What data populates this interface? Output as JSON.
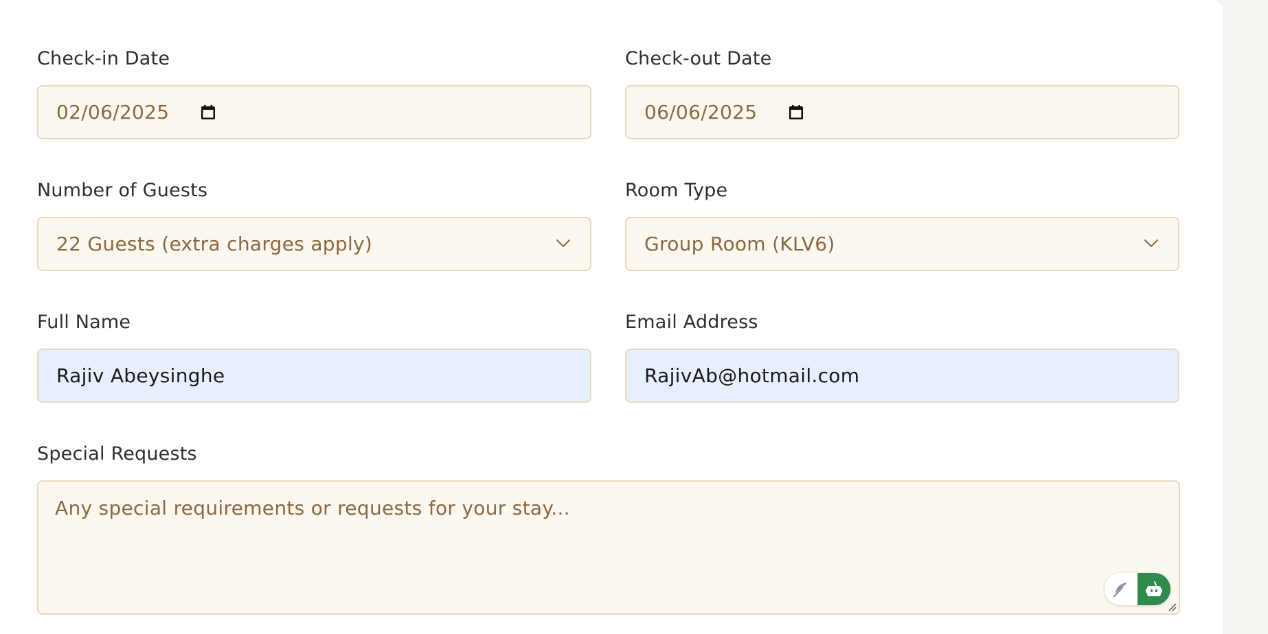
{
  "form": {
    "checkin": {
      "label": "Check-in Date",
      "value": "02/06/2025"
    },
    "checkout": {
      "label": "Check-out Date",
      "value": "06/06/2025"
    },
    "guests": {
      "label": "Number of Guests",
      "value": "22 Guests (extra charges apply)"
    },
    "room_type": {
      "label": "Room Type",
      "value": "Group Room (KLV6)"
    },
    "full_name": {
      "label": "Full Name",
      "value": "Rajiv Abeysinghe"
    },
    "email": {
      "label": "Email Address",
      "value": "RajivAb@hotmail.com"
    },
    "special_requests": {
      "label": "Special Requests",
      "placeholder": "Any special requirements or requests for your stay..."
    }
  },
  "icons": {
    "date": "calendar-icon",
    "select": "chevron-down-icon",
    "widget_left": "feather-icon",
    "widget_right": "robot-icon"
  },
  "colors": {
    "input_bg": "#fcf7ef",
    "input_border": "#ead9bf",
    "autofill_bg": "#e8effc",
    "placeholder_text": "#8a6a44",
    "widget_accent": "#2f8a4c"
  }
}
